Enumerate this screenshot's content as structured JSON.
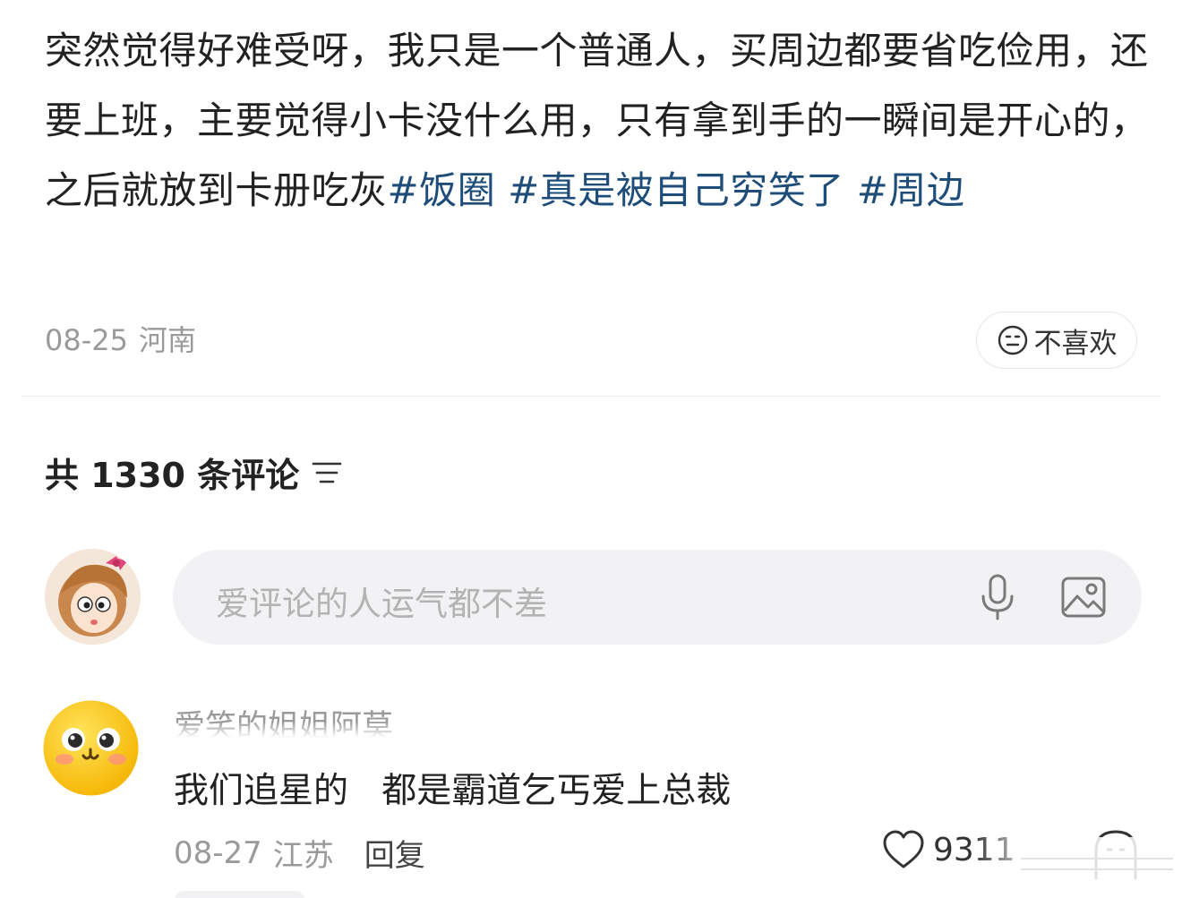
{
  "post": {
    "text_segments": [
      "突然觉得好难受呀，我只是一个普通人，买周边都要省吃俭用，还要上班，主要觉得小卡没什么用，只有拿到手的一瞬间是开心的，之后就放到卡册吃灰"
    ],
    "hashtags": [
      "#饭圈",
      "#真是被自己穷笑了",
      "#周边"
    ],
    "date": "08-25",
    "location": "河南",
    "dislike_label": "不喜欢"
  },
  "comments_section": {
    "header": "共 1330 条评论",
    "input_placeholder": "爱评论的人运气都不差"
  },
  "comment": {
    "author": "爱笑的姐姐阿莫",
    "text": "我们追星的   都是霸道乞丐爱上总裁",
    "date": "08-27",
    "location": "江苏",
    "reply_label": "回复",
    "like_count": "9311"
  },
  "colors": {
    "hashtag": "#1f4d7a",
    "text": "#222222",
    "meta": "#9a9a9a"
  },
  "icons": {
    "dislike": "neutral-face-icon",
    "sort": "sort-lines-icon",
    "mic": "microphone-icon",
    "image": "image-icon",
    "like": "heart-icon",
    "extra": "ghost-icon"
  }
}
